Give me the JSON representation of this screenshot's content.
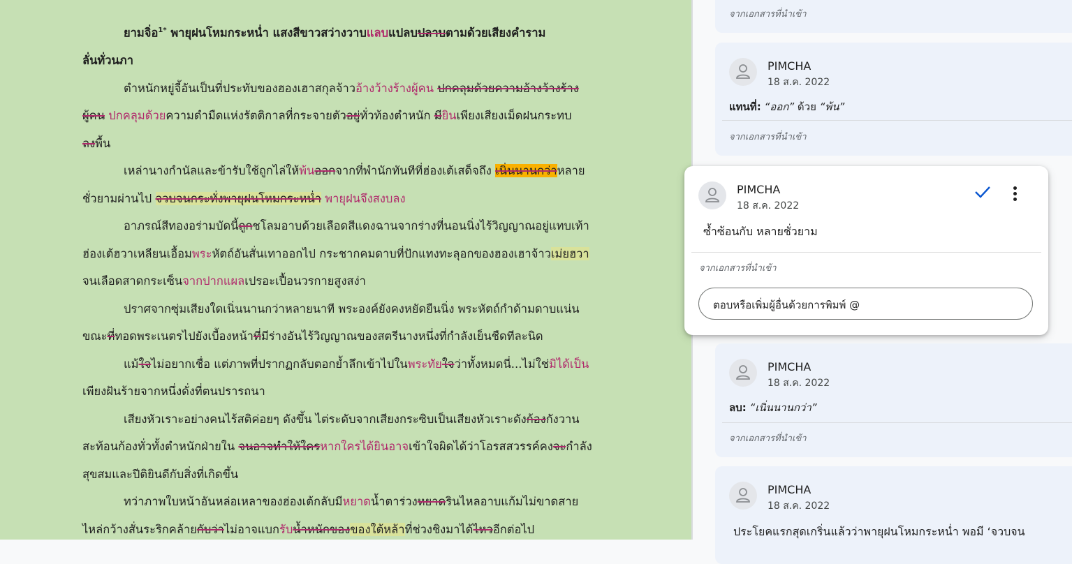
{
  "document": {
    "lines": [
      {
        "indent": true,
        "title": true,
        "segments": [
          {
            "t": "ยามจิ่อ"
          },
          {
            "t": "1*",
            "sup": true
          },
          {
            "t": " พายุฝนโหมกระหน่ำ แสงสีขาวสว่างวาบ"
          },
          {
            "t": "แลบ",
            "ins": true
          },
          {
            "t": "แปลบ"
          },
          {
            "t": "ปลาบ",
            "del": true
          },
          {
            "t": "ตามด้วยเสียงคำราม"
          }
        ]
      },
      {
        "indent": false,
        "title": true,
        "segments": [
          {
            "t": "ลั่นทั่วนภา"
          }
        ]
      },
      {
        "indent": true,
        "segments": [
          {
            "t": "ตำหนักหยู่จี้อันเป็นที่ประทับของฮองเฮาสกุลจ้าว"
          },
          {
            "t": "อ้างว้างร้างผู้คน",
            "ins": true
          },
          {
            "t": " "
          },
          {
            "t": "ปกคลุมด้วยความอ้างว้างร้าง",
            "del": true
          }
        ]
      },
      {
        "indent": false,
        "segments": [
          {
            "t": "ผู้คน",
            "del": true
          },
          {
            "t": " "
          },
          {
            "t": "ปกคลุมด้วย",
            "ins": true
          },
          {
            "t": "ความดำมืดแห่งรัตติกาลที่กระจายตัว"
          },
          {
            "t": "อยู่",
            "del": true
          },
          {
            "t": "ทั่วท้องตำหนัก "
          },
          {
            "t": "มี",
            "del": true
          },
          {
            "t": "ยิน",
            "ins": true
          },
          {
            "t": "เพียงเสียงเม็ดฝนกระทบ"
          }
        ]
      },
      {
        "indent": false,
        "segments": [
          {
            "t": "ลง",
            "del": true
          },
          {
            "t": "พื้น"
          }
        ]
      },
      {
        "indent": true,
        "segments": [
          {
            "t": "เหล่านางกำนัลและข้ารับใช้ถูกไล่ให้"
          },
          {
            "t": "พ้น",
            "ins": true
          },
          {
            "t": "ออก",
            "del": true
          },
          {
            "t": "จากที่พำนักทันทีที่ฮ่องเต้เสด็จถึง "
          },
          {
            "t": "เนิ่นนานกว่า",
            "del": true,
            "hl": "o"
          },
          {
            "t": "หลาย"
          }
        ]
      },
      {
        "indent": false,
        "segments": [
          {
            "t": "ชั่วยามผ่านไป "
          },
          {
            "t": "จวบจนกระทั่งพายุฝนโหมกระหน่ำ",
            "del": true,
            "hl": "y"
          },
          {
            "t": "  "
          },
          {
            "t": "พายุฝนจึงสงบลง",
            "ins": true
          }
        ]
      },
      {
        "indent": true,
        "segments": [
          {
            "t": "อาภรณ์สีทองอร่ามบัดนี้"
          },
          {
            "t": "ถูก",
            "del": true
          },
          {
            "t": "ชโลมอาบด้วยเลือดสีแดงฉานจากร่างที่นอนนิ่งไร้วิญญาณอยู่แทบเท้า"
          }
        ]
      },
      {
        "indent": false,
        "segments": [
          {
            "t": "ฮ่องเต้ฮวาเหลียนเอื้อม"
          },
          {
            "t": "พระ",
            "ins": true
          },
          {
            "t": "หัตถ์อันสั่นเทาออกไป กระชากคมดาบที่ปักแทงทะลุอกของฮองเฮาจ้าว"
          },
          {
            "t": "เม่ยฮวา",
            "hl": "y"
          }
        ]
      },
      {
        "indent": false,
        "segments": [
          {
            "t": "จนเลือดสาดกระเซ็น"
          },
          {
            "t": "จากปากแผล",
            "ins": true
          },
          {
            "t": "เปรอะเปื้อนวรกายสูงสง่า"
          }
        ]
      },
      {
        "indent": true,
        "segments": [
          {
            "t": "ปราศจากซุ่มเสียงใดเนิ่นนานกว่าหลายนาที พระองค์ยังคงหยัดยืนนิ่ง พระหัตถ์กำด้ามดาบแน่น"
          }
        ]
      },
      {
        "indent": false,
        "segments": [
          {
            "t": "ขณะ"
          },
          {
            "t": "ที่",
            "del": true
          },
          {
            "t": "ทอดพระเนตรไปยังเบื้องหน้า"
          },
          {
            "t": "ที่",
            "del": true
          },
          {
            "t": "มีร่างอันไร้วิญญาณของสตรีนางหนึ่งที่กำลังเย็นชืดทีละนิด"
          }
        ]
      },
      {
        "indent": true,
        "segments": [
          {
            "t": "แม้"
          },
          {
            "t": "ใจ",
            "del": true
          },
          {
            "t": "ไม่อยากเชื่อ แต่ภาพที่ปรากฏกลับตอกย้ำลึกเข้าไปใน"
          },
          {
            "t": "พระทัย",
            "ins": true
          },
          {
            "t": "ใจ",
            "del": true
          },
          {
            "t": "ว่าทั้งหมดนี่...ไม่ใช่"
          },
          {
            "t": "มิได้เป็น",
            "ins": true
          }
        ]
      },
      {
        "indent": false,
        "segments": [
          {
            "t": "เพียงฝันร้ายจากหนึ่งดั่งที่ตนปรารถนา"
          }
        ]
      },
      {
        "indent": true,
        "segments": [
          {
            "t": "เสียงหัวเราะอย่างคนไร้สติค่อยๆ ดังขึ้น ไต่ระดับจากเสียงกระซิบเป็นเสียงหัวเราะดัง"
          },
          {
            "t": "ก้อง",
            "del": true
          },
          {
            "t": "กังวาน"
          }
        ]
      },
      {
        "indent": false,
        "segments": [
          {
            "t": "สะท้อนก้องทั่วทั้งตำหนักฝ่ายใน "
          },
          {
            "t": "จนอาจทำให้ใคร",
            "del": true
          },
          {
            "t": "หากใครได้ยินอาจ",
            "ins": true
          },
          {
            "t": "เข้าใจผิดได้ว่าโอรสสวรรค์คง"
          },
          {
            "t": "จะ",
            "del": true
          },
          {
            "t": "กำลัง"
          }
        ]
      },
      {
        "indent": false,
        "segments": [
          {
            "t": "สุขสมและปีติยินดีกับสิ่งที่เกิดขึ้น"
          }
        ]
      },
      {
        "indent": true,
        "segments": [
          {
            "t": "ทว่าภาพใบหน้าอันหล่อเหลาของฮ่องเต้"
          },
          {
            "t": "กลับมี"
          },
          {
            "t": "หยาด",
            "ins": true
          },
          {
            "t": "น้ำตาร่วง"
          },
          {
            "t": "หยาด",
            "del": true
          },
          {
            "t": "รินไหลอาบแก้มไม่ขาดสาย"
          }
        ]
      },
      {
        "indent": false,
        "segments": [
          {
            "t": "ไหล่กว้างสั่นระริกคล้าย"
          },
          {
            "t": "กับว่า",
            "del": true
          },
          {
            "t": "ไม่อาจแบก"
          },
          {
            "t": "รับ",
            "ins": true
          },
          {
            "t": "น้ำหนักของ",
            "del": true
          },
          {
            "t": "ของใต้หล้า",
            "hl": "y"
          },
          {
            "t": "ที่ช่วงชิงมาได้"
          },
          {
            "t": "ไหว",
            "del": true
          },
          {
            "t": "อีกต่อไป"
          }
        ]
      }
    ]
  },
  "comments": {
    "card1": {
      "source": "จากเอกสารที่นำเข้า"
    },
    "card2": {
      "name": "PIMCHA",
      "date": "18 ส.ค. 2022",
      "label": "แทนที่:",
      "old": "“ออก”",
      "mid": " ด้วย ",
      "new": "“พ้น”",
      "source": "จากเอกสารที่นำเข้า"
    },
    "active": {
      "name": "PIMCHA",
      "date": "18 ส.ค. 2022",
      "text": "ซ้ำซ้อนกับ หลายชั่วยาม",
      "source": "จากเอกสารที่นำเข้า",
      "reply_placeholder": "ตอบหรือเพิ่มผู้อื่นด้วยการพิมพ์ @"
    },
    "card4": {
      "name": "PIMCHA",
      "date": "18 ส.ค. 2022",
      "label": "ลบ:",
      "value": "“เนิ่นนานกว่า”",
      "source": "จากเอกสารที่นำเข้า"
    },
    "card5": {
      "name": "PIMCHA",
      "date": "18 ส.ค. 2022",
      "text": "ประโยคแรกสุดเกริ่นแล้วว่าพายุฝนโหมกระหน่ำ พอมี ‘จวบจน"
    }
  },
  "colors": {
    "doc_bg": "#c6e0b4",
    "insert": "#b02a6b",
    "highlight_yellow": "#d9e29a",
    "highlight_orange": "#f9b100",
    "card_bg": "#edf2fa",
    "check": "#0b57d0"
  },
  "icons": [
    "person-icon",
    "check-icon",
    "more-vert-icon"
  ]
}
